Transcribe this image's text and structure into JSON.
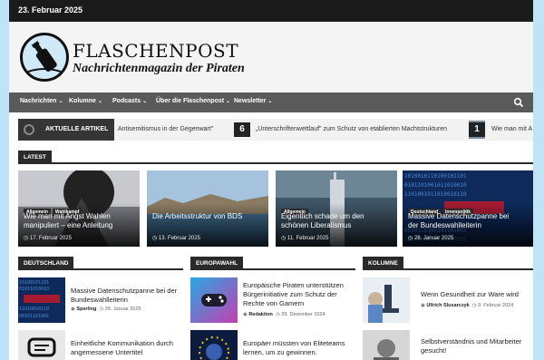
{
  "topbar": {
    "date": "23. Februar 2025"
  },
  "logo": {
    "title": "FLASCHENPOST",
    "subtitle": "Nachrichtenmagazin der Piraten"
  },
  "nav": {
    "items": [
      {
        "label": "Nachrichten"
      },
      {
        "label": "Kolumne"
      },
      {
        "label": "Podcasts"
      },
      {
        "label": "Über die Flaschenpost"
      },
      {
        "label": "Newsletter"
      }
    ],
    "search_icon": "search-icon"
  },
  "ticker": {
    "label": "AKTUELLE ARTIKEL",
    "items": [
      {
        "text": "Antisemitismus in der Gegenwart\""
      },
      {
        "num": "6",
        "text": "„Unterschriftenwettlauf\" zum Schutz von etablierten Machtstrukturen"
      },
      {
        "num": "1",
        "text": "Wie man mit A"
      }
    ]
  },
  "latest": {
    "heading": "LATEST",
    "cards": [
      {
        "tags": [
          "Allgemein",
          "Wahlkampf"
        ],
        "title": "Wie man mit Angst Wahlen manipuliert – eine Anleitung",
        "date": "17. Februar 2025"
      },
      {
        "tags": [],
        "title": "Die Arbeitsstruktur von BDS",
        "date": "13. Februar 2025"
      },
      {
        "tags": [
          "Allgemein"
        ],
        "title": "Eigentlich schade um den schönen Liberalismus",
        "date": "11. Februar 2025"
      },
      {
        "tags": [
          "Deutschland",
          "Innenpolitik"
        ],
        "title": "Massive Datenschutzpanne bei der Bundeswahlleiterin",
        "date": "28. Januar 2025"
      }
    ]
  },
  "columns": [
    {
      "heading": "DEUTSCHLAND",
      "items": [
        {
          "title": "Massive Datenschutzpanne bei der Bundeswahlleiterin",
          "author": "Sperling",
          "date": "28. Januar 2025"
        },
        {
          "title": "Einheitliche Kommunikation durch angemessene Untertitel",
          "author": "",
          "date": ""
        }
      ]
    },
    {
      "heading": "EUROPAWAHL",
      "items": [
        {
          "title": "Europäische Piraten unterstützen Bürgerinitiative zum Schutz der Rechte von Gamern",
          "author": "Redaktion",
          "date": "29. Dezember 2024"
        },
        {
          "title": "Europäer müssten von Eliteteams lernen, um zu gewinnen.",
          "author": "",
          "date": ""
        }
      ]
    },
    {
      "heading": "KOLUMNE",
      "items": [
        {
          "title": "Wenn Gesundheit zur Ware wird",
          "author": "Ullrich Slusarczyk",
          "date": "9. Februar 2024"
        },
        {
          "title": "Selbstverständnis und Mitarbeiter gesucht!",
          "author": "",
          "date": ""
        }
      ]
    }
  ]
}
